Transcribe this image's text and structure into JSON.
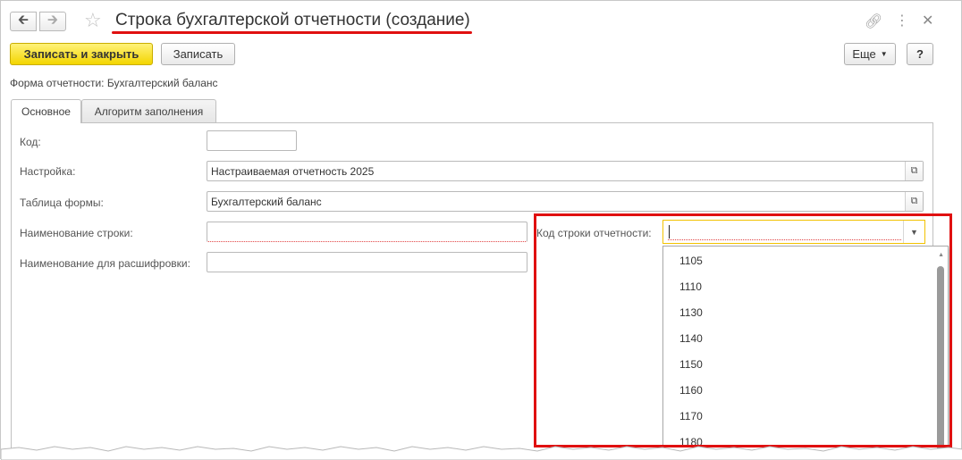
{
  "window": {
    "title": "Строка бухгалтерской отчетности (создание)",
    "nav_back_icon": "arrow-left-icon",
    "nav_forward_icon": "arrow-right-icon"
  },
  "toolbar": {
    "save_close_label": "Записать и закрыть",
    "save_label": "Записать",
    "more_label": "Еще",
    "help_label": "?"
  },
  "form": {
    "caption": "Форма отчетности: Бухгалтерский баланс"
  },
  "tabs": [
    {
      "label": "Основное"
    },
    {
      "label": "Алгоритм заполнения"
    }
  ],
  "fields": {
    "code_label": "Код:",
    "code_value": "",
    "settings_label": "Настройка:",
    "settings_value": "Настраиваемая отчетность 2025",
    "table_label": "Таблица формы:",
    "table_value": "Бухгалтерский баланс",
    "row_name_label": "Наименование строки:",
    "row_name_value": "",
    "decode_name_label": "Наименование для расшифровки:",
    "decode_name_value": "",
    "report_code_label": "Код строки отчетности:",
    "report_code_value": ""
  },
  "dropdown": {
    "options": [
      "1105",
      "1110",
      "1130",
      "1140",
      "1150",
      "1160",
      "1170",
      "1180"
    ]
  },
  "colors": {
    "primary_button": "#f3d500",
    "highlight": "#e01010",
    "focus_border": "#f2c200"
  }
}
